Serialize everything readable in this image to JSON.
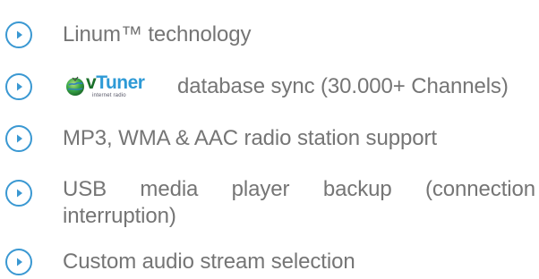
{
  "features": [
    {
      "text": "Linum™ technology"
    },
    {
      "logo": {
        "brand_v": "v",
        "brand_rest": "Tuner",
        "tagline": "internet radio",
        "icon": "vtuner-globe-icon"
      },
      "text": "database sync (30.000+ Channels)"
    },
    {
      "text": "MP3, WMA & AAC radio station support"
    },
    {
      "text_line1": "USB media player backup (connection",
      "text_line2": "interruption)"
    },
    {
      "text": "Custom audio stream selection"
    }
  ],
  "bullet_icon": "play-circle-icon",
  "colors": {
    "bullet": "#3a98d2",
    "text": "#757575",
    "vtuner_green": "#1a8a3a",
    "vtuner_blue": "#2e9ad6"
  }
}
